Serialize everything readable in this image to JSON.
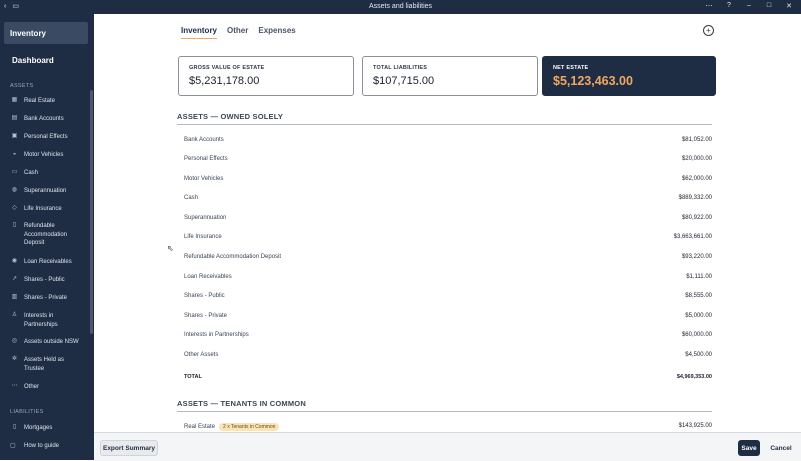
{
  "window": {
    "title": "Assets and liabilities"
  },
  "sidebar": {
    "top_item": "Inventory",
    "dashboard": "Dashboard",
    "assets_header": "ASSETS",
    "asset_items": [
      {
        "label": "Real Estate",
        "icon": "building-icon"
      },
      {
        "label": "Bank Accounts",
        "icon": "bank-icon"
      },
      {
        "label": "Personal Effects",
        "icon": "box-icon"
      },
      {
        "label": "Motor Vehicles",
        "icon": "car-icon"
      },
      {
        "label": "Cash",
        "icon": "cash-icon"
      },
      {
        "label": "Superannuation",
        "icon": "piggy-bank-icon"
      },
      {
        "label": "Life Insurance",
        "icon": "shield-icon"
      },
      {
        "label": "Refundable Accommodation Deposit",
        "icon": "document-icon"
      },
      {
        "label": "Loan Receivables",
        "icon": "coin-icon"
      },
      {
        "label": "Shares - Public",
        "icon": "trend-icon"
      },
      {
        "label": "Shares - Private",
        "icon": "chart-icon"
      },
      {
        "label": "Interests in Partnerships",
        "icon": "people-icon"
      },
      {
        "label": "Assets outside NSW",
        "icon": "globe-icon"
      },
      {
        "label": "Assets Held as Trustee",
        "icon": "gear-icon"
      },
      {
        "label": "Other",
        "icon": "ellipsis-icon"
      }
    ],
    "liabilities_header": "LIABILITIES",
    "liability_items": [
      {
        "label": "Mortgages",
        "icon": "document-icon"
      }
    ],
    "how_to": "How to guide"
  },
  "tabs": [
    "Inventory",
    "Other",
    "Expenses"
  ],
  "cards": {
    "gross": {
      "label": "GROSS VALUE OF ESTATE",
      "value": "$5,231,178.00"
    },
    "liabilities": {
      "label": "TOTAL LIABILITIES",
      "value": "$107,715.00"
    },
    "net": {
      "label": "NET ESTATE",
      "value": "$5,123,463.00"
    }
  },
  "owned_solely": {
    "title": "ASSETS — OWNED SOLELY",
    "rows": [
      {
        "label": "Bank Accounts",
        "value": "$81,052.00"
      },
      {
        "label": "Personal Effects",
        "value": "$20,000.00"
      },
      {
        "label": "Motor Vehicles",
        "value": "$62,000.00"
      },
      {
        "label": "Cash",
        "value": "$889,332.00"
      },
      {
        "label": "Superannuation",
        "value": "$80,922.00"
      },
      {
        "label": "Life Insurance",
        "value": "$3,663,661.00"
      },
      {
        "label": "Refundable Accommodation Deposit",
        "value": "$93,220.00"
      },
      {
        "label": "Loan Receivables",
        "value": "$1,111.00"
      },
      {
        "label": "Shares - Public",
        "value": "$8,555.00"
      },
      {
        "label": "Shares - Private",
        "value": "$5,000.00"
      },
      {
        "label": "Interests in Partnerships",
        "value": "$60,000.00"
      },
      {
        "label": "Other Assets",
        "value": "$4,500.00"
      }
    ],
    "total_label": "TOTAL",
    "total_value": "$4,969,353.00"
  },
  "tenants_in_common": {
    "title": "ASSETS — TENANTS IN COMMON",
    "rows": [
      {
        "label": "Real Estate",
        "badge": "2 x Tenants in Common",
        "value": "$143,925.00"
      }
    ]
  },
  "footer": {
    "export": "Export Summary",
    "save": "Save",
    "cancel": "Cancel"
  },
  "colors": {
    "sidebar_bg": "#1f2d44",
    "accent": "#f0a860",
    "badge_bg": "#fbe3b5"
  }
}
